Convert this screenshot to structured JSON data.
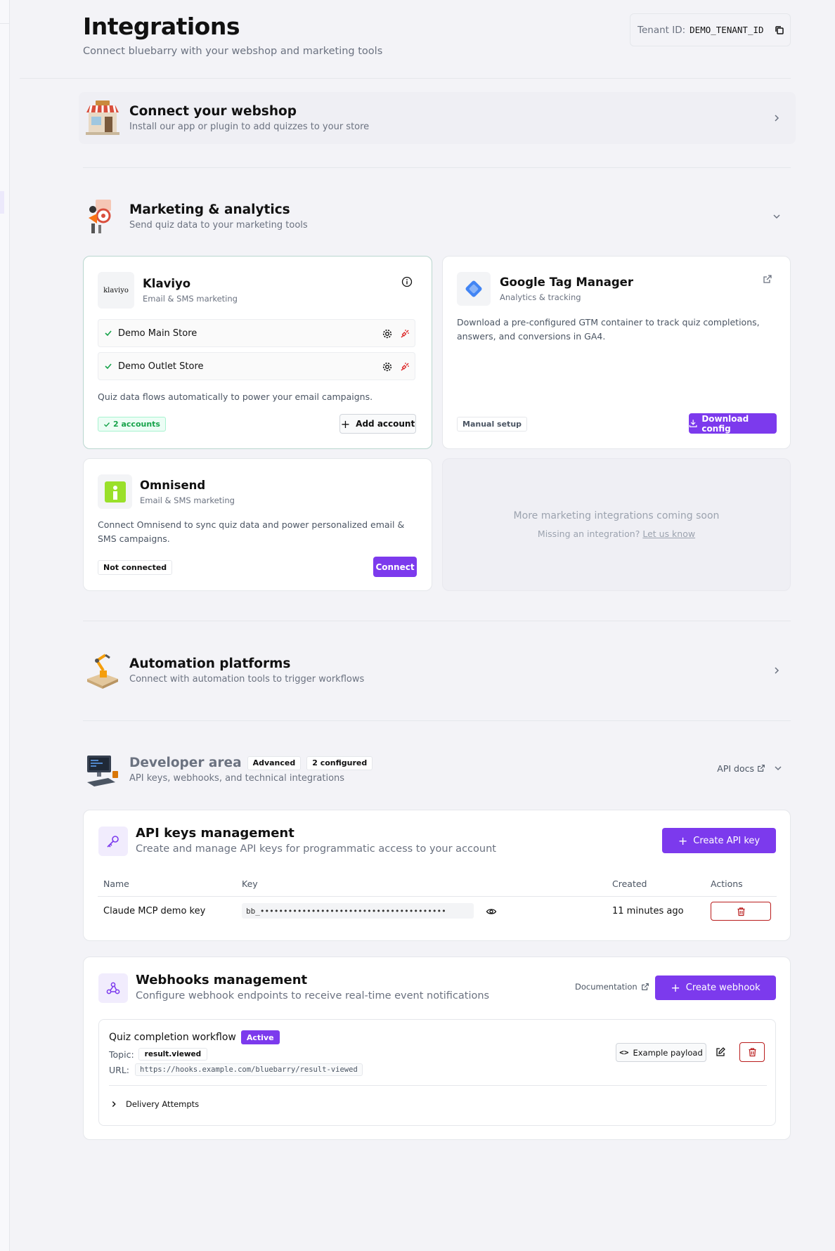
{
  "page": {
    "title": "Integrations",
    "subtitle": "Connect bluebarry with your webshop and marketing tools",
    "tenant_label": "Tenant ID:",
    "tenant_value": "DEMO_TENANT_ID"
  },
  "sections": {
    "webshop": {
      "title": "Connect your webshop",
      "desc": "Install our app or plugin to add quizzes to your store"
    },
    "marketing": {
      "title": "Marketing & analytics",
      "desc": "Send quiz data to your marketing tools"
    },
    "automation": {
      "title": "Automation platforms",
      "desc": "Connect with automation tools to trigger workflows"
    },
    "developer": {
      "title": "Developer area",
      "desc": "API keys, webhooks, and technical integrations",
      "badge_advanced": "Advanced",
      "badge_configured": "2 configured",
      "api_docs": "API docs"
    }
  },
  "klaviyo": {
    "logo_text": "klaviyo",
    "name": "Klaviyo",
    "category": "Email & SMS marketing",
    "accounts": [
      "Demo Main Store",
      "Demo Outlet Store"
    ],
    "desc": "Quiz data flows automatically to power your email campaigns.",
    "badge": "2 accounts",
    "add_button": "Add account"
  },
  "gtm": {
    "name": "Google Tag Manager",
    "category": "Analytics & tracking",
    "desc": "Download a pre-configured GTM container to track quiz completions, answers, and conversions in GA4.",
    "badge": "Manual setup",
    "button": "Download config"
  },
  "omnisend": {
    "name": "Omnisend",
    "category": "Email & SMS marketing",
    "desc": "Connect Omnisend to sync quiz data and power personalized email & SMS campaigns.",
    "badge": "Not connected",
    "button": "Connect"
  },
  "coming_soon": {
    "title": "More marketing integrations coming soon",
    "missing_text": "Missing an integration?",
    "link": "Let us know"
  },
  "api_keys": {
    "title": "API keys management",
    "desc": "Create and manage API keys for programmatic access to your account",
    "create_button": "Create API key",
    "columns": [
      "Name",
      "Key",
      "Created",
      "Actions"
    ],
    "rows": [
      {
        "name": "Claude MCP demo key",
        "key": "bb_••••••••••••••••••••••••••••••••••••••••",
        "created": "11 minutes ago"
      }
    ]
  },
  "webhooks": {
    "title": "Webhooks management",
    "desc": "Configure webhook endpoints to receive real-time event notifications",
    "docs_link": "Documentation",
    "create_button": "Create webhook",
    "item": {
      "name": "Quiz completion workflow",
      "status": "Active",
      "topic_label": "Topic:",
      "topic": "result.viewed",
      "url_label": "URL:",
      "url": "https://hooks.example.com/bluebarry/result-viewed",
      "example_button": "Example payload",
      "delivery_label": "Delivery Attempts"
    }
  },
  "colors": {
    "accent": "#7c3aed",
    "danger": "#b91c1c",
    "success": "#16a34a",
    "background": "#f3f3f7"
  }
}
